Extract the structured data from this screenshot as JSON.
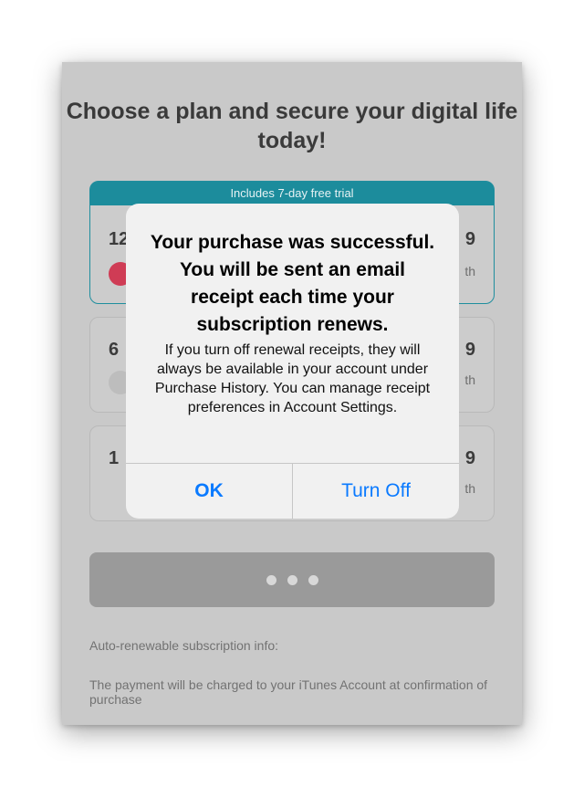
{
  "headline": "Choose a plan and secure your digital life today!",
  "plans": [
    {
      "badge": "Includes 7-day free trial",
      "label": "12",
      "price": "9",
      "per": "th",
      "selected": true
    },
    {
      "label": "6",
      "price": "9",
      "per": "th",
      "selected": false
    },
    {
      "label": "1",
      "price": "9",
      "per": "th",
      "selected": false
    }
  ],
  "action_button": {
    "state": "loading"
  },
  "info": {
    "heading": "Auto-renewable subscription info:",
    "text": "The payment will be charged to your iTunes Account at confirmation of purchase"
  },
  "alert": {
    "title": "Your purchase was successful. You will be sent an email receipt each time your subscription renews.",
    "message": "If you turn off renewal receipts, they will always be available in your account under Purchase History. You can manage receipt preferences in Account Settings.",
    "ok_label": "OK",
    "turn_off_label": "Turn Off"
  },
  "colors": {
    "accent": "#1c8c9c",
    "selected_radio": "#cf3c55",
    "alert_button": "#0a7aff"
  }
}
